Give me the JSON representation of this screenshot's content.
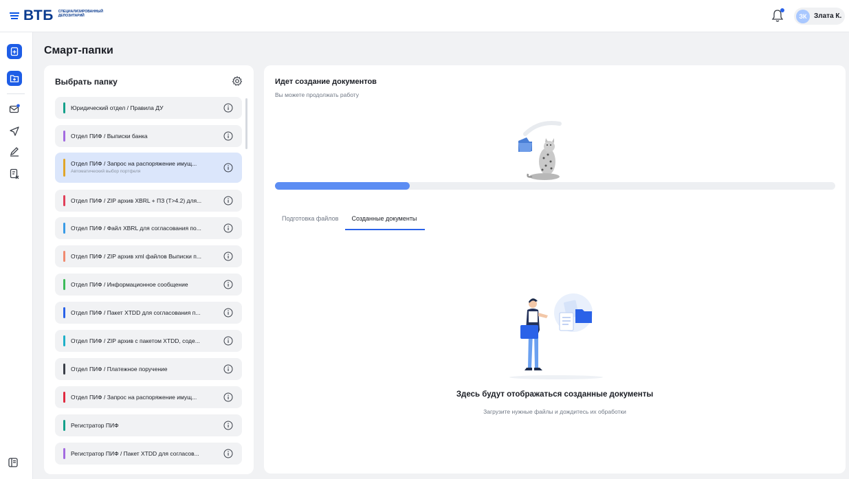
{
  "header": {
    "logo_text": "ВТБ",
    "logo_sub_line1": "Специализированный",
    "logo_sub_line2": "депозитарий",
    "user_initials": "ЗК",
    "user_name": "Злата К.",
    "icons": [
      "bell-icon",
      "avatar"
    ]
  },
  "rail": {
    "items": [
      {
        "name": "add-document",
        "icon": "file-plus-icon",
        "active": true
      },
      {
        "name": "smart-folders",
        "icon": "folder-plus-icon",
        "active": true
      },
      {
        "name": "mail",
        "icon": "mail-icon",
        "active": false
      },
      {
        "name": "send",
        "icon": "send-icon",
        "active": false
      },
      {
        "name": "sign",
        "icon": "pen-icon",
        "active": false
      },
      {
        "name": "document-cancel",
        "icon": "document-x-icon",
        "active": false
      }
    ],
    "bottom_icon": "panel-icon"
  },
  "page": {
    "title": "Смарт-папки"
  },
  "folders": {
    "header": "Выбрать папку",
    "items": [
      {
        "label": "Юридический отдел / Правила ДУ",
        "color": "#14a08a"
      },
      {
        "label": "Отдел ПИФ / Выписки банка",
        "color": "#a36be0"
      },
      {
        "label": "Отдел ПИФ / Запрос на распоряжение имущ...",
        "sub": "Автоматический выбор портфеля",
        "color": "#e0a52a",
        "selected": true
      },
      {
        "label": "Отдел ПИФ / ZIP архив XBRL + ПЗ (T>4.2) для...",
        "color": "#e0405a"
      },
      {
        "label": "Отдел ПИФ / Файл XBRL для согласования по...",
        "color": "#3a9be6"
      },
      {
        "label": "Отдел ПИФ / ZIP архив xml файлов Выписки п...",
        "color": "#f08a70"
      },
      {
        "label": "Отдел ПИФ / Информационное сообщение",
        "color": "#3dbb5a"
      },
      {
        "label": "Отдел ПИФ / Пакет XTDD для согласования п...",
        "color": "#2a62e8"
      },
      {
        "label": "Отдел ПИФ / ZIP архив с пакетом XTDD, соде...",
        "color": "#1fb0c8"
      },
      {
        "label": "Отдел ПИФ / Платежное поручение",
        "color": "#3a3f48"
      },
      {
        "label": "Отдел ПИФ / Запрос на распоряжение имущ...",
        "color": "#e02a40"
      },
      {
        "label": "Регистратор ПИФ",
        "color": "#14a08a"
      },
      {
        "label": "Регистратор ПИФ / Пакет XTDD для согласов...",
        "color": "#a36be0"
      }
    ]
  },
  "status": {
    "title": "Идет создание документов",
    "subtitle": "Вы можете продолжать работу",
    "progress": 0.24
  },
  "tabs": [
    {
      "label": "Подготовка файлов",
      "active": false
    },
    {
      "label": "Созданные документы",
      "active": true
    }
  ],
  "empty": {
    "title": "Здесь будут отображаться созданные документы",
    "subtitle": "Загрузите нужные файлы и дождитесь их обработки"
  },
  "colors": {
    "accent": "#2a62e8",
    "progress": "#5c8df3",
    "selected_bg": "#dbe6fb"
  }
}
